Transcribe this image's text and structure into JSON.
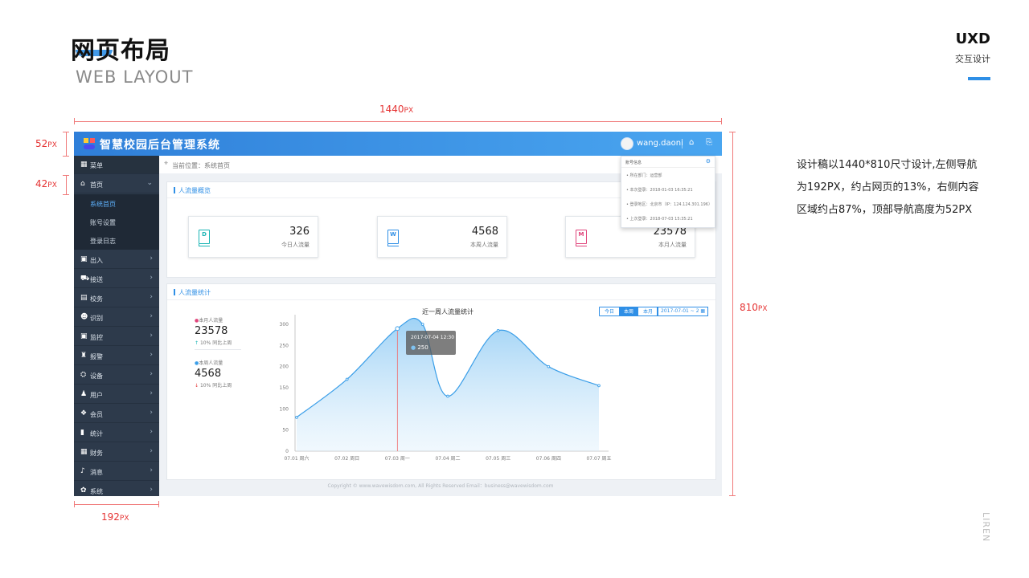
{
  "slide": {
    "title_cn": "网页布局",
    "title_en": "WEB LAYOUT",
    "brand": "UXD",
    "brand_sub": "交互设计",
    "side_mark": "LIREN",
    "description": "设计稿以1440*810尺寸设计,左侧导航为192PX，约占网页的13%，右侧内容区域约占87%，顶部导航高度为52PX"
  },
  "dimensions": {
    "width": "1440",
    "height": "810",
    "header": "52",
    "menu_item": "42",
    "sidebar": "192",
    "unit": "PX"
  },
  "app": {
    "title": "智慧校园后台管理系统",
    "user": "wang.daoni",
    "breadcrumb": "当前位置：系统首页",
    "sidebar": {
      "header": "菜单",
      "home": "首页",
      "home_sub": [
        "系统首页",
        "账号设置",
        "登录日志"
      ],
      "items": [
        "出入",
        "接送",
        "校务",
        "识别",
        "监控",
        "报警",
        "设备",
        "用户",
        "会员",
        "统计",
        "财务",
        "消息",
        "系统"
      ]
    },
    "overview": {
      "title": "人流量概览",
      "cards": [
        {
          "letter": "D",
          "value": "326",
          "caption": "今日人流量",
          "color": "#19b4b4"
        },
        {
          "letter": "W",
          "value": "4568",
          "caption": "本周人流量",
          "color": "#2f8fe6"
        },
        {
          "letter": "M",
          "value": "23578",
          "caption": "本月人流量",
          "color": "#e0457b"
        }
      ]
    },
    "dropdown": {
      "title": "账号信息",
      "rows": [
        "• 所在部门：运营部",
        "• 本次登录：2018-01-03 16:35:21",
        "• 登录地区：北京市（IP：124.124.301.196）",
        "• 上次登录：2018-07-03 15:35:21"
      ]
    },
    "stats": {
      "title": "人流量统计",
      "month_label": "本月人流量",
      "month_value": "23578",
      "month_change": "10%",
      "month_change_label": "同比上周",
      "week_label": "本周人流量",
      "week_value": "4568",
      "week_change": "10%",
      "week_change_label": "同比上周",
      "ranges": [
        "今日",
        "本周",
        "本月"
      ],
      "range_selected": "本周",
      "date_range": "2017-07-01 ~ 2"
    },
    "tooltip": {
      "date": "2017-07-04  12:30",
      "value": "250"
    },
    "copyright": "Copyright © www.wavewisdom.com, All Rights Reserved   Email：business@wavewisdom.com"
  },
  "chart_data": {
    "type": "area",
    "title": "近一周人流量统计",
    "categories": [
      "07.01  周六",
      "07.02  周日",
      "07.03  周一",
      "07.04  周二",
      "07.05  周三",
      "07.06  周四",
      "07.07  周五"
    ],
    "x": [
      0,
      1,
      2,
      2.5,
      3,
      4,
      5,
      6
    ],
    "values": [
      80,
      170,
      290,
      300,
      130,
      285,
      200,
      155
    ],
    "ylim": [
      0,
      300
    ],
    "yticks": [
      0,
      50,
      100,
      150,
      200,
      250,
      300
    ],
    "highlight_x": 2,
    "color": "#3a9ee8"
  }
}
